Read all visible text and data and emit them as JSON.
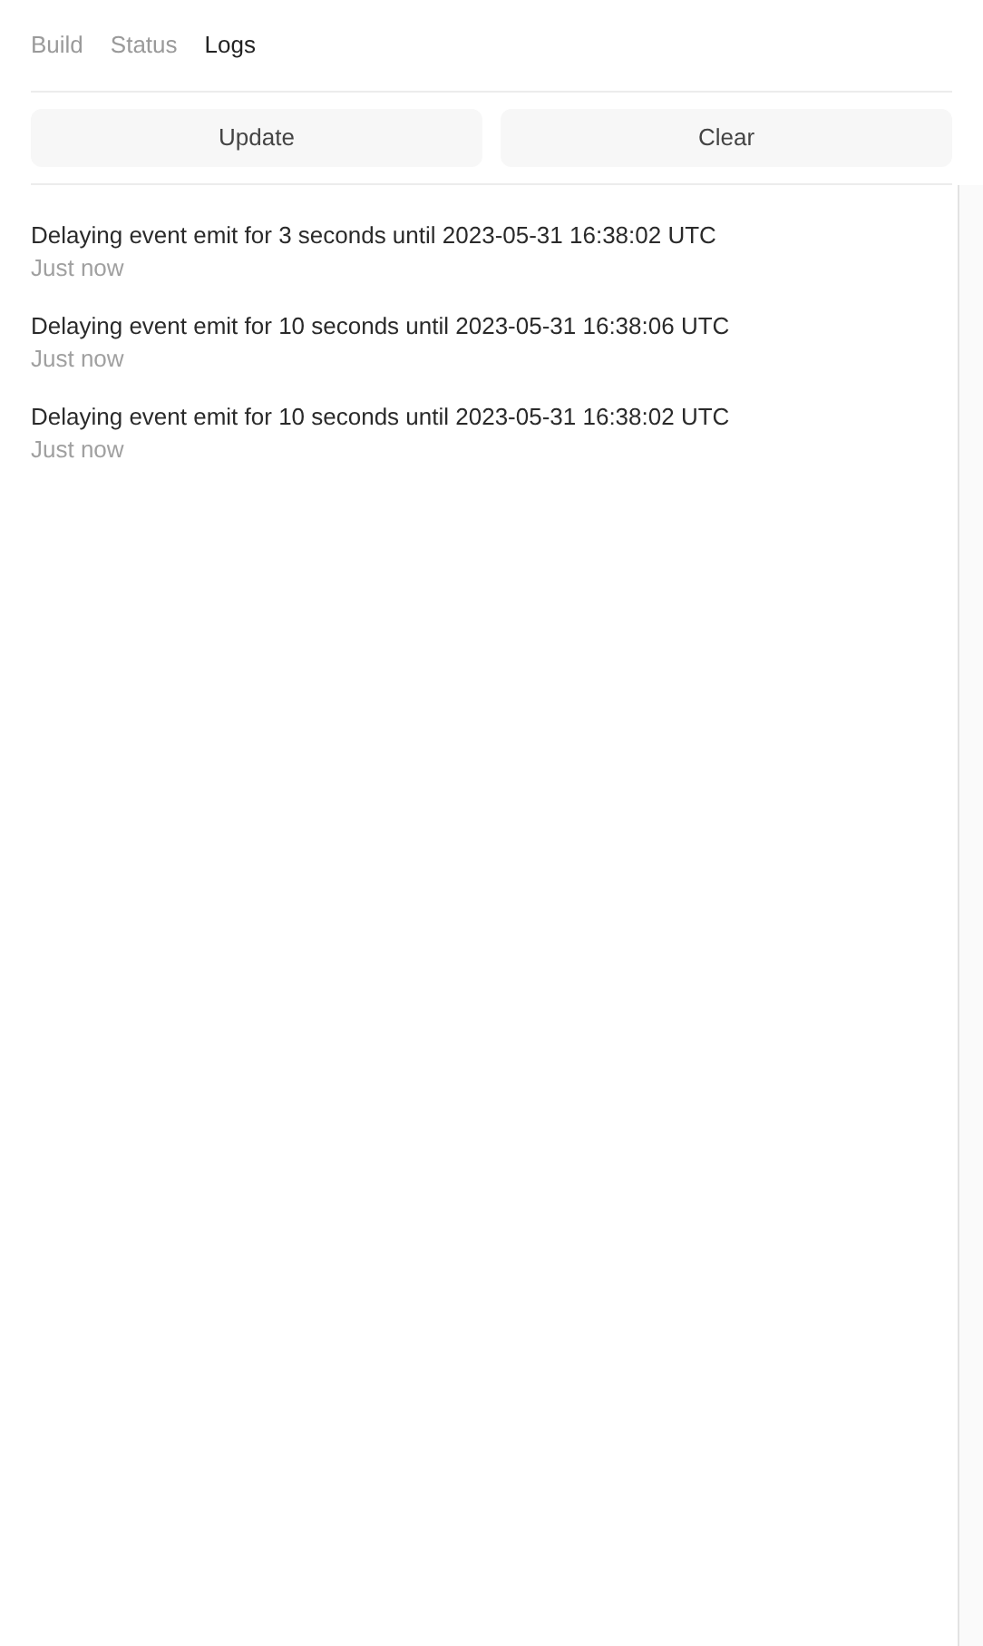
{
  "tabs": [
    {
      "label": "Build",
      "selected": false
    },
    {
      "label": "Status",
      "selected": false
    },
    {
      "label": "Logs",
      "selected": true
    }
  ],
  "buttons": [
    "Update",
    "Clear"
  ],
  "logs": [
    {
      "message": "Delaying event emit for 3 seconds until 2023-05-31 16:38:02 UTC",
      "time": "Just now"
    },
    {
      "message": "Delaying event emit for 10 seconds until 2023-05-31 16:38:06 UTC",
      "time": "Just now"
    },
    {
      "message": "Delaying event emit for 10 seconds until 2023-05-31 16:38:02 UTC",
      "time": "Just now"
    }
  ]
}
